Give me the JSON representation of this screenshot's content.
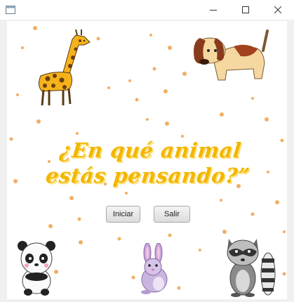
{
  "window": {
    "app_icon": "window-app-icon",
    "controls": [
      "minimize-icon",
      "maximize-icon",
      "close-icon"
    ]
  },
  "main": {
    "heading": {
      "line1": "¿En qué animal",
      "line2": "estás pensando?”"
    },
    "buttons": {
      "start_label": "Iniciar",
      "exit_label": "Salir"
    }
  },
  "colors": {
    "heading": "#f2b600",
    "dots": "#f0a04b",
    "background": "#ffffff"
  },
  "illustrations": [
    "giraffe",
    "dog",
    "panda",
    "rabbit",
    "raccoon"
  ]
}
